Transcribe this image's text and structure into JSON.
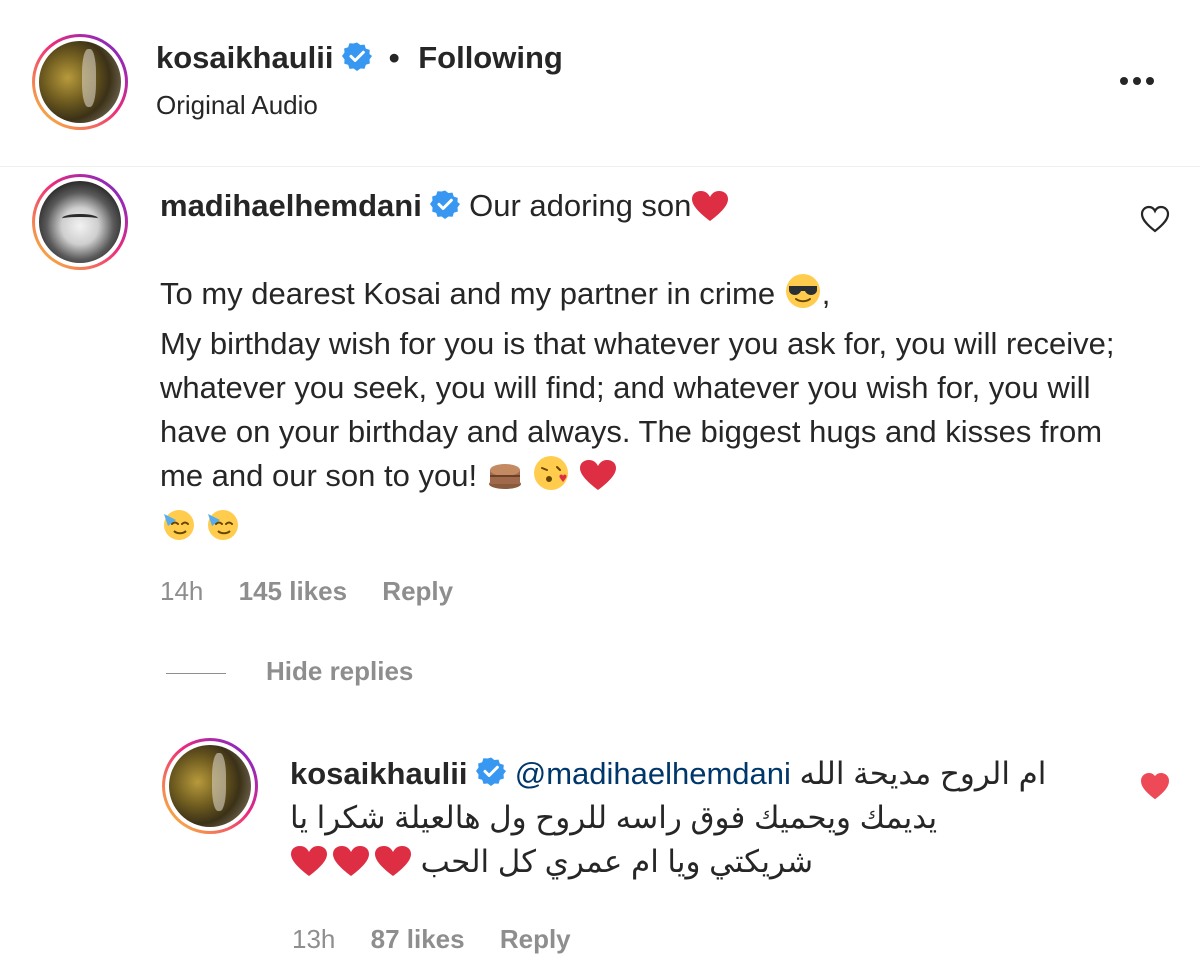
{
  "header": {
    "username": "kosaikhaulii",
    "separator": "•",
    "follow_status": "Following",
    "subtitle": "Original Audio",
    "more_icon": "more-horizontal-icon"
  },
  "comment": {
    "username": "madihaelhemdani",
    "caption": "Our adoring son",
    "body_line1": "To my dearest Kosai and my partner in crime",
    "body_line1_suffix": ",",
    "body_line2": "My birthday wish for you is that whatever you ask for, you will receive; whatever you seek, you will find; and whatever you wish for, you will have on your birthday and always. The biggest hugs and kisses from me and our son to you!",
    "time": "14h",
    "likes": "145 likes",
    "reply_label": "Reply",
    "liked": false
  },
  "replies_toggle": "Hide replies",
  "reply": {
    "username": "kosaikhaulii",
    "mention": "@madihaelhemdani",
    "text_line1": "ام الروح مديحة الله",
    "text_line2": "يديمك ويحميك فوق راسه للروح ول هالعيلة شكرا يا",
    "text_line3": "شريكتي ويا ام عمري كل الحب",
    "time": "13h",
    "likes": "87 likes",
    "reply_label": "Reply",
    "liked": true
  },
  "colors": {
    "text": "#262626",
    "muted": "#8e8e8e",
    "verified": "#3897f0",
    "heart_red": "#ed4956",
    "mention": "#00376b"
  }
}
